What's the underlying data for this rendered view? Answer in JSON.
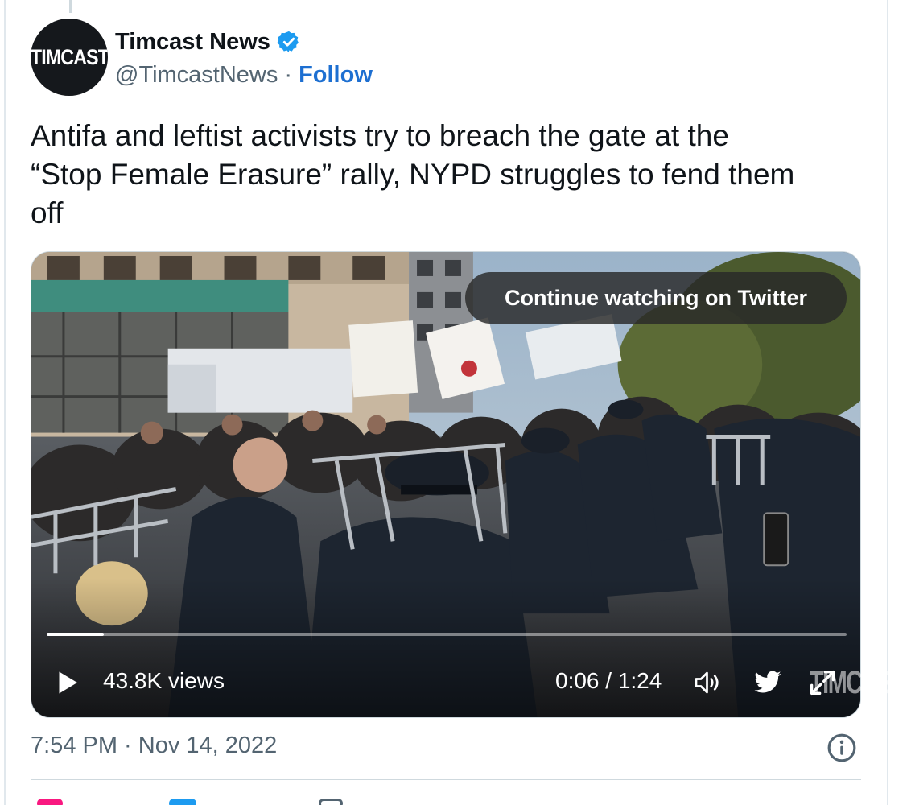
{
  "author": {
    "avatar_text": "TIMCAST",
    "display_name": "Timcast News",
    "handle": "@TimcastNews",
    "separator": "·",
    "follow_label": "Follow",
    "verified_icon": "verified-badge-icon"
  },
  "tweet": {
    "text_line1": "Antifa and leftist activists try to breach the gate at the",
    "text_line2": "“Stop Female Erasure” rally, NYPD struggles to fend them",
    "text_line3": "off"
  },
  "video": {
    "continue_label": "Continue watching on Twitter",
    "views": "43.8K views",
    "time": "0:06 / 1:24",
    "progress_fraction": 0.071,
    "watermark": "TIMCAST",
    "icons": [
      "play-icon",
      "volume-icon",
      "twitter-bird-icon",
      "expand-icon"
    ]
  },
  "footer": {
    "timestamp": "7:54 PM · Nov 14, 2022",
    "info_icon": "info-icon"
  },
  "colors": {
    "link": "#1d6fd1",
    "verified": "#1d9bf0",
    "secondary_text": "#536471",
    "like": "#f91880"
  }
}
